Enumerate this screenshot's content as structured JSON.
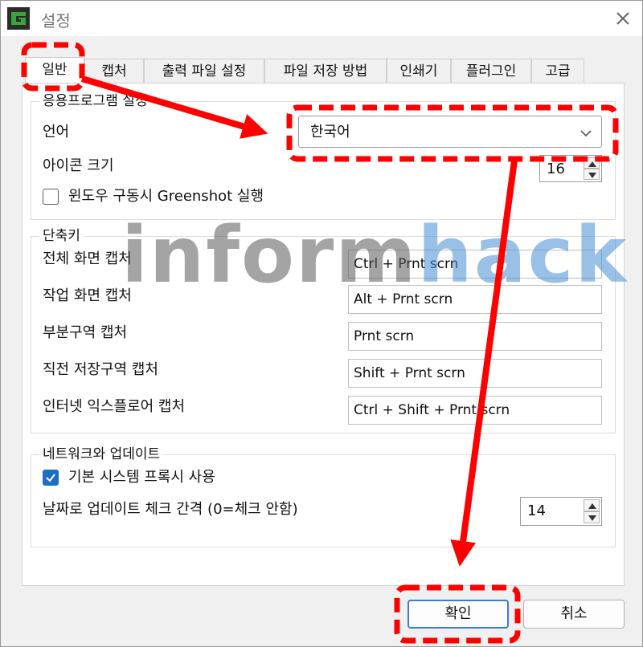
{
  "window": {
    "title": "설정"
  },
  "tabs": [
    {
      "label": "일반",
      "active": true
    },
    {
      "label": "캡처"
    },
    {
      "label": "출력 파일 설정"
    },
    {
      "label": "파일 저장 방법"
    },
    {
      "label": "인쇄기"
    },
    {
      "label": "플러그인"
    },
    {
      "label": "고급"
    }
  ],
  "app_settings": {
    "legend": "응용프로그램 설정",
    "language_label": "언어",
    "language_value": "한국어",
    "icon_size_label": "아이콘 크기",
    "icon_size_value": "16",
    "autostart_label": "윈도우 구동시 Greenshot 실행",
    "autostart_checked": false
  },
  "hotkeys": {
    "legend": "단축키",
    "items": [
      {
        "label": "전체 화면 캡처",
        "value": "Ctrl + Prnt scrn"
      },
      {
        "label": "작업 화면 캡처",
        "value": "Alt + Prnt scrn"
      },
      {
        "label": "부분구역 캡처",
        "value": "Prnt scrn"
      },
      {
        "label": "직전 저장구역 캡처",
        "value": "Shift + Prnt scrn"
      },
      {
        "label": "인터넷 익스플로어 캡처",
        "value": "Ctrl + Shift + Prnt scrn"
      }
    ]
  },
  "network": {
    "legend": "네트워크와 업데이트",
    "proxy_label": "기본 시스템 프록시 사용",
    "proxy_checked": true,
    "update_label": "날짜로 업데이트 체크 간격 (0=체크 안함)",
    "update_value": "14"
  },
  "buttons": {
    "ok": "확인",
    "cancel": "취소"
  },
  "watermark": {
    "part1": "inform",
    "part2": "hack"
  },
  "colors": {
    "annotation_red": "#ff0000",
    "checkbox_blue": "#1a6fc4",
    "app_icon_green": "#3aa63a"
  }
}
